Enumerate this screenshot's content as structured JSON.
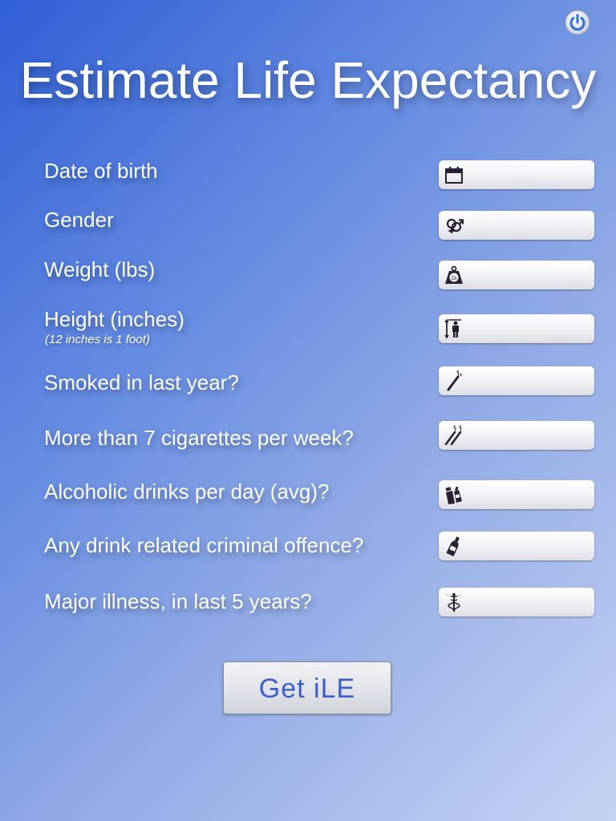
{
  "header": {
    "title": "Estimate Life Expectancy",
    "power_icon": "power-icon"
  },
  "form": {
    "fields": [
      {
        "key": "dob",
        "label": "Date of birth",
        "icon": "calendar-icon",
        "value": ""
      },
      {
        "key": "gender",
        "label": "Gender",
        "icon": "gender-icon",
        "value": ""
      },
      {
        "key": "weight",
        "label": "Weight (lbs)",
        "icon": "weight-icon",
        "value": ""
      },
      {
        "key": "height",
        "label": "Height (inches)",
        "sublabel": "(12 inches is 1 foot)",
        "icon": "height-icon",
        "value": ""
      },
      {
        "key": "smoked",
        "label": "Smoked in last year?",
        "icon": "cigarette-icon",
        "value": ""
      },
      {
        "key": "cigs",
        "label": "More than 7 cigarettes per week?",
        "icon": "cigarettes-icon",
        "value": ""
      },
      {
        "key": "alcohol",
        "label": "Alcoholic drinks per day (avg)?",
        "icon": "drinks-icon",
        "value": ""
      },
      {
        "key": "offence",
        "label": "Any drink related criminal offence?",
        "icon": "bottle-icon",
        "value": ""
      },
      {
        "key": "illness",
        "label": "Major illness, in last 5 years?",
        "icon": "caduceus-icon",
        "value": ""
      }
    ]
  },
  "actions": {
    "submit_label": "Get iLE"
  },
  "colors": {
    "accent": "#3a5fcf",
    "background_top": "#2f5fd6",
    "background_bottom": "#c6d3f2"
  }
}
